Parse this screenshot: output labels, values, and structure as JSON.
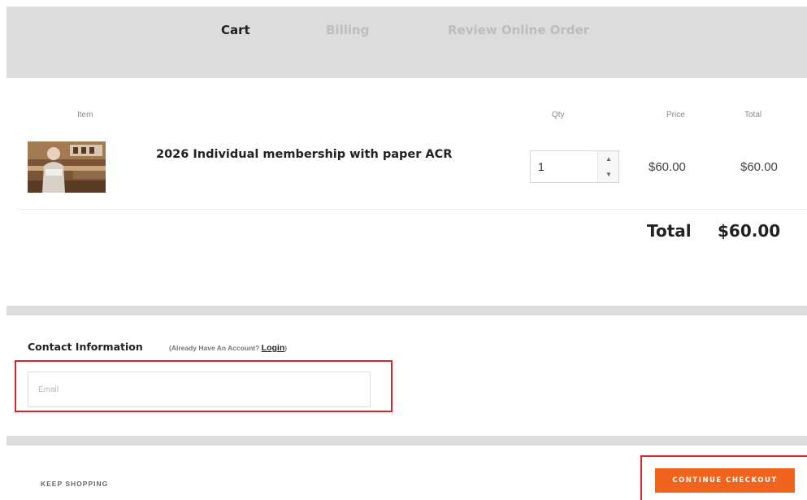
{
  "steps": [
    {
      "label": "Cart",
      "state": "active"
    },
    {
      "label": "Billing",
      "state": "inactive"
    },
    {
      "label": "Review Online Order",
      "state": "inactive"
    }
  ],
  "table": {
    "headers": {
      "item": "Item",
      "qty": "Qty",
      "price": "Price",
      "total": "Total"
    },
    "rows": [
      {
        "name": "2026 Individual membership with paper ACR",
        "qty": "1",
        "price": "$60.00",
        "total": "$60.00",
        "thumbnail": "product-photo"
      }
    ]
  },
  "summary": {
    "label": "Total",
    "value": "$60.00"
  },
  "contact": {
    "title": "Contact Information",
    "note_prefix": "(Already Have An Account? ",
    "login_label": "Login",
    "note_suffix": ")",
    "email_placeholder": "Email",
    "email_value": ""
  },
  "actions": {
    "keep_shopping": "KEEP SHOPPING",
    "continue_checkout": "CONTINUE CHECKOUT"
  },
  "colors": {
    "accent": "#f0641e",
    "highlight": "#d9232e",
    "band": "#dcdcdc"
  },
  "icons": {
    "spin_up": "caret-up-icon",
    "spin_down": "caret-down-icon"
  }
}
